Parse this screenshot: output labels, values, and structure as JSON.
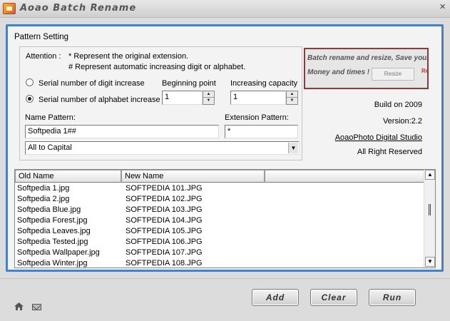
{
  "window": {
    "title": "Aoao Batch Rename",
    "close_glyph": "×"
  },
  "pattern": {
    "label": "Pattern Setting",
    "attention_label": "Attention :",
    "attention_1": "* Represent the original extension.",
    "attention_2": "# Represent automatic increasing digit or alphabet.",
    "radio_digit": "Serial number of digit increase",
    "radio_alpha": "Serial number of alphabet increase",
    "beginning_label": "Beginning point",
    "beginning_value": "1",
    "capacity_label": "Increasing capacity",
    "capacity_value": "1",
    "name_pattern_label": "Name Pattern:",
    "name_pattern_value": "Softpedia 1##",
    "ext_pattern_label": "Extension Pattern:",
    "ext_pattern_value": "*",
    "case_value": "All to Capital"
  },
  "ad": {
    "line1": "Batch rename and resize, Save your",
    "line2": "Money and times !",
    "button1": "Resize",
    "button2": "Rena"
  },
  "info": {
    "build": "Build on 2009",
    "version": "Version:2.2",
    "studio": "AoaoPhoto Digital Studio",
    "rights": "All Right Reserved"
  },
  "list": {
    "headers": [
      "Old Name",
      "New Name"
    ],
    "rows": [
      {
        "old": "Softpedia 1.jpg",
        "new": "SOFTPEDIA 101.JPG"
      },
      {
        "old": "Softpedia 2.jpg",
        "new": "SOFTPEDIA 102.JPG"
      },
      {
        "old": "Softpedia Blue.jpg",
        "new": "SOFTPEDIA 103.JPG"
      },
      {
        "old": "Softpedia Forest.jpg",
        "new": "SOFTPEDIA 104.JPG"
      },
      {
        "old": "Softpedia Leaves.jpg",
        "new": "SOFTPEDIA 105.JPG"
      },
      {
        "old": "Softpedia Tested.jpg",
        "new": "SOFTPEDIA 106.JPG"
      },
      {
        "old": "Softpedia Wallpaper.jpg",
        "new": "SOFTPEDIA 107.JPG"
      },
      {
        "old": "Softpedia Winter.jpg",
        "new": "SOFTPEDIA 108.JPG"
      }
    ]
  },
  "buttons": {
    "add": "Add",
    "clear": "Clear",
    "run": "Run"
  },
  "icons": {
    "home": "home-icon",
    "mail": "mail-icon"
  },
  "colors": {
    "panel_border": "#4a7fc2",
    "scroll_thumb": "#cc0000",
    "ad_border": "#8c3a3a"
  }
}
